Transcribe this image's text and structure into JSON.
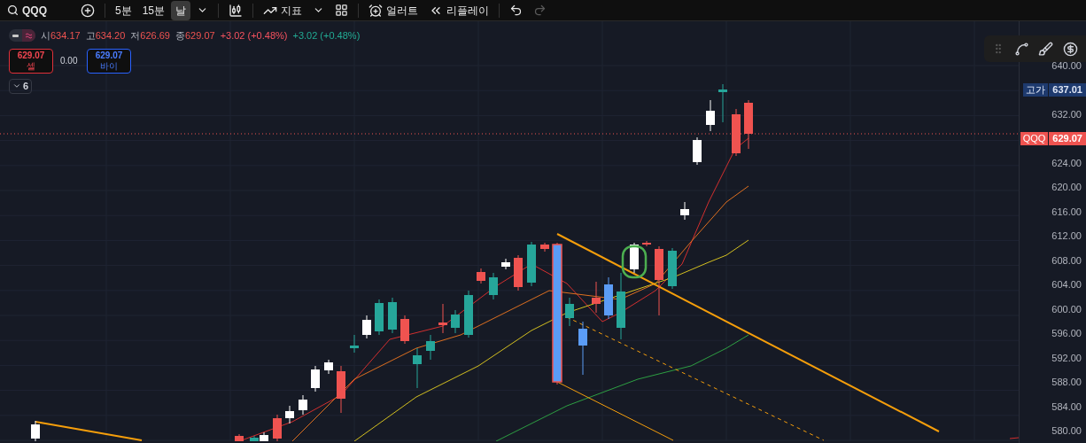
{
  "toolbar": {
    "symbol": "QQQ",
    "intervals": [
      {
        "label": "5분",
        "selected": false
      },
      {
        "label": "15분",
        "selected": false
      },
      {
        "label": "날",
        "selected": true
      }
    ],
    "indicators": "지표",
    "alert": "얼러트",
    "replay": "리플레이",
    "redo_disabled": true
  },
  "legend": {
    "wave_active": true,
    "values": [
      {
        "key": "시",
        "value": "634.17"
      },
      {
        "key": "고",
        "value": "634.20"
      },
      {
        "key": "저",
        "value": "626.69"
      },
      {
        "key": "종",
        "value": "629.07"
      }
    ],
    "changes": [
      {
        "text": "+3.02 (+0.48%)",
        "color": "#f7525f"
      },
      {
        "text": "+3.02 (+0.48%)",
        "color": "#22ab94"
      }
    ]
  },
  "trade": {
    "sell": {
      "price": "629.07",
      "label": "셀"
    },
    "spread": "0.00",
    "buy": {
      "price": "629.07",
      "label": "바이"
    }
  },
  "indicator_group": {
    "count": "6",
    "expanded": false
  },
  "axis": {
    "ticks": [
      {
        "label": "640.00"
      },
      {
        "badge": {
          "kind": "high",
          "tag": "고가",
          "price": "637.01"
        }
      },
      {
        "label": "632.00"
      },
      {
        "badge": {
          "kind": "last",
          "tag": "QQQ",
          "price": "629.07"
        }
      },
      {
        "label": "624.00"
      },
      {
        "label": "620.00"
      },
      {
        "label": "616.00"
      },
      {
        "label": "612.00"
      },
      {
        "label": "608.00"
      },
      {
        "label": "604.00"
      },
      {
        "label": "600.00"
      },
      {
        "label": "596.00"
      },
      {
        "label": "592.00"
      },
      {
        "label": "588.00"
      },
      {
        "label": "584.00"
      },
      {
        "label": "580.00"
      }
    ]
  }
}
